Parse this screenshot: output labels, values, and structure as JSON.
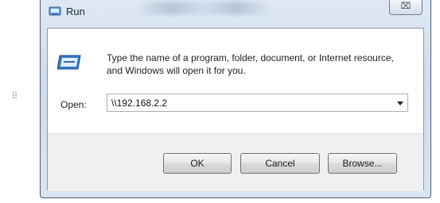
{
  "window": {
    "title": "Run",
    "close_glyph": "⌧",
    "icon": "run-app-icon"
  },
  "dialog": {
    "description": "Type the name of a program, folder, document, or Internet resource, and Windows will open it for you.",
    "open_label": "Open:",
    "open_value": "\\\\192.168.2.2",
    "icon": "run-icon"
  },
  "buttons": {
    "ok": "OK",
    "cancel": "Cancel",
    "browse": "Browse..."
  },
  "side": {
    "grip_glyph": "⠿"
  }
}
